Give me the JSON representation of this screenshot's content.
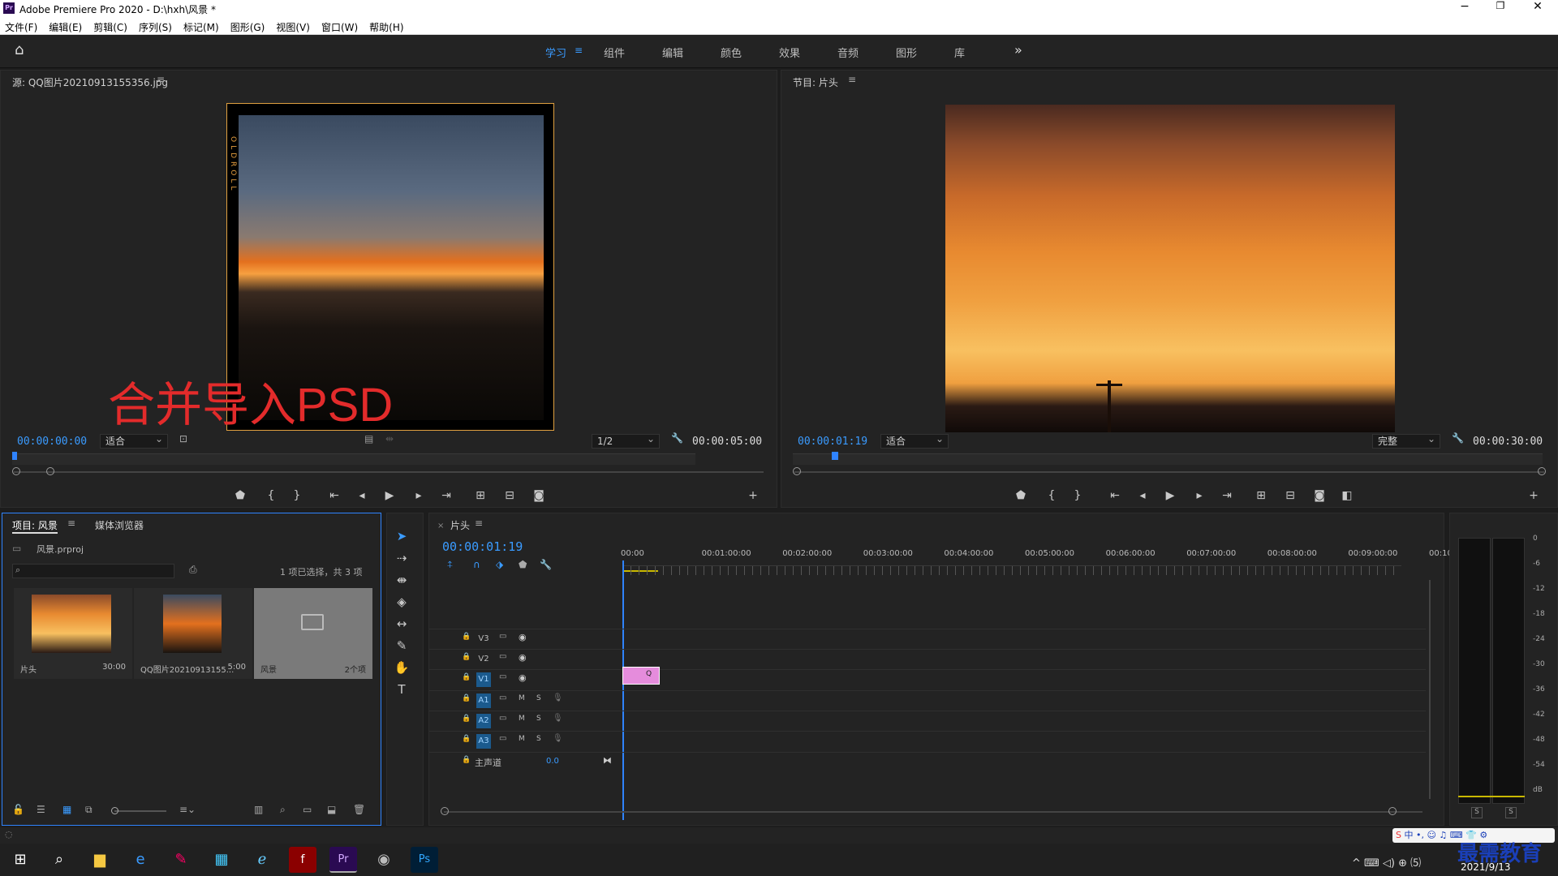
{
  "app": {
    "title": "Adobe Premiere Pro 2020 - D:\\hxh\\风景 *"
  },
  "menu": [
    "文件(F)",
    "编辑(E)",
    "剪辑(C)",
    "序列(S)",
    "标记(M)",
    "图形(G)",
    "视图(V)",
    "窗口(W)",
    "帮助(H)"
  ],
  "workspaces": [
    "学习",
    "组件",
    "编辑",
    "颜色",
    "效果",
    "音频",
    "图形",
    "库"
  ],
  "source": {
    "title": "源: QQ图片20210913155356.jpg",
    "timecode_in": "00:00:00:00",
    "fit": "适合",
    "resolution": "1/2",
    "timecode_dur": "00:00:05:00",
    "overlay_text": "合并导入PSD"
  },
  "program": {
    "title": "节目: 片头",
    "timecode": "00:00:01:19",
    "fit": "适合",
    "quality": "完整",
    "duration": "00:00:30:00"
  },
  "project": {
    "tab_project": "项目: 风景",
    "tab_media": "媒体浏览器",
    "file": "风景.prproj",
    "selection_info": "1 项已选择，共 3 项",
    "items": [
      {
        "name": "片头",
        "meta": "30:00"
      },
      {
        "name": "QQ图片20210913155...",
        "meta": "5:00"
      },
      {
        "name": "风景",
        "meta": "2个项"
      }
    ]
  },
  "timeline": {
    "tab": "片头",
    "timecode": "00:00:01:19",
    "ruler": [
      "00:00",
      "00:01:00:00",
      "00:02:00:00",
      "00:03:00:00",
      "00:04:00:00",
      "00:05:00:00",
      "00:06:00:00",
      "00:07:00:00",
      "00:08:00:00",
      "00:09:00:00",
      "00:10"
    ],
    "video_tracks": [
      "V3",
      "V2",
      "V1"
    ],
    "audio_tracks": [
      "A1",
      "A2",
      "A3"
    ],
    "master_label": "主声道",
    "master_value": "0.0",
    "clip_label": "Q"
  },
  "meter": {
    "scale": [
      "0",
      "-6",
      "-12",
      "-18",
      "-24",
      "-30",
      "-36",
      "-42",
      "-48",
      "-54",
      "dB"
    ]
  },
  "taskbar": {
    "date": "2021/9/13",
    "watermark": "最需教育"
  },
  "colors": {
    "accent": "#3a9bff",
    "clip": "#e58cdc",
    "playhead": "#2f83ff",
    "watermark": "#1a3fb8",
    "overlay": "#e32b2b"
  }
}
